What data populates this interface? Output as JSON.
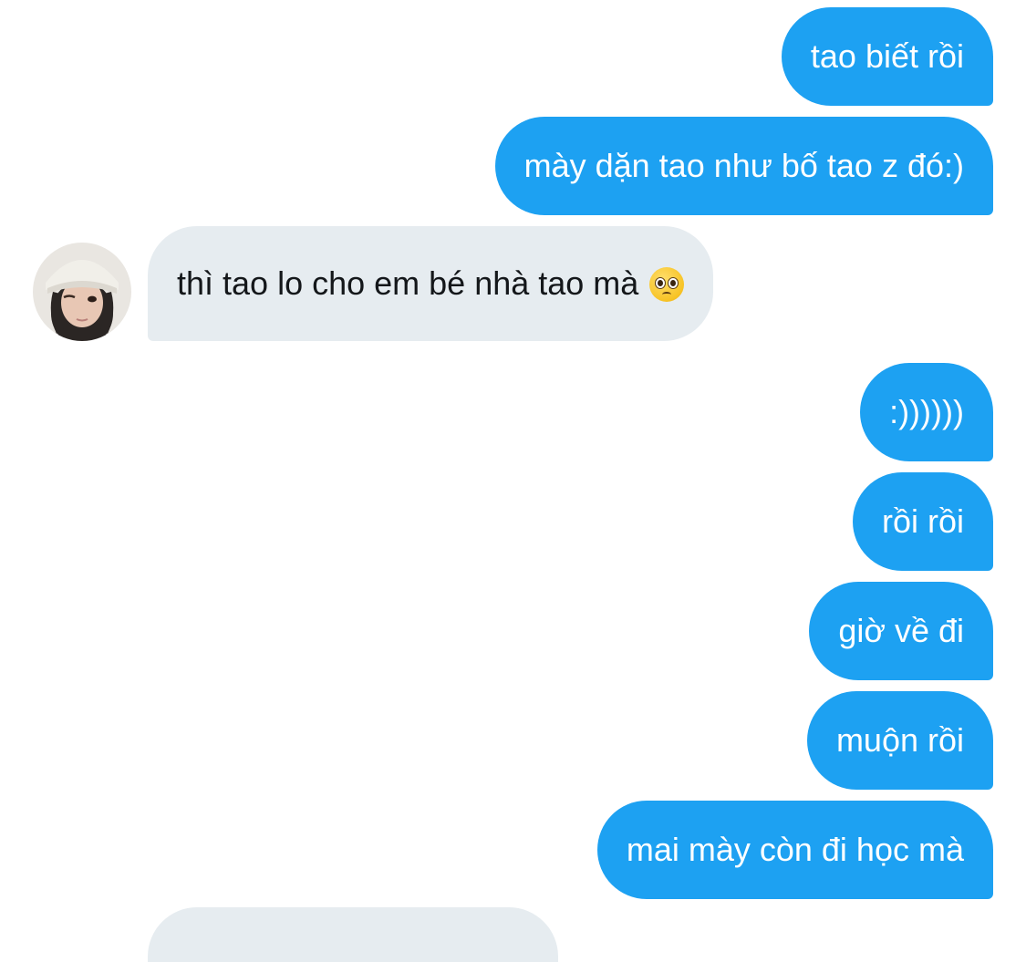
{
  "conversation": {
    "messages": [
      {
        "sender": "me",
        "text": "tao biết rồi"
      },
      {
        "sender": "me",
        "text": "mày dặn tao như bố tao z đó:)"
      },
      {
        "sender": "other",
        "text": "thì tao lo cho em bé nhà tao mà",
        "emoji": "pleading-face"
      },
      {
        "sender": "me",
        "text": ":))))))"
      },
      {
        "sender": "me",
        "text": "rồi rồi"
      },
      {
        "sender": "me",
        "text": "giờ về đi"
      },
      {
        "sender": "me",
        "text": "muộn rồi"
      },
      {
        "sender": "me",
        "text": "mai mày còn đi học mà"
      }
    ]
  },
  "colors": {
    "sent_bubble": "#1da1f2",
    "received_bubble": "#e6ecf0",
    "sent_text": "#ffffff",
    "received_text": "#14171a"
  }
}
